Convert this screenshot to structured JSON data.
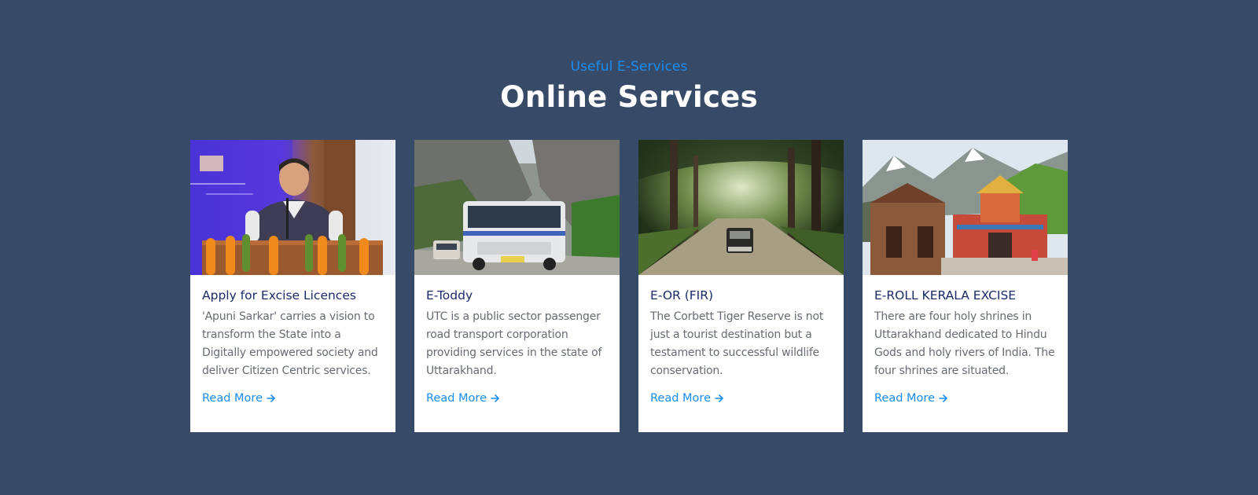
{
  "section": {
    "eyebrow": "Useful E-Services",
    "title": "Online Services"
  },
  "cards": [
    {
      "title": "Apply for Excise Licences",
      "text": "'Apuni Sarkar' carries a vision to transform the State into a Digitally empowered society and deliver Citizen Centric services.",
      "link": "Read More",
      "image": "speaker-at-podium-photo"
    },
    {
      "title": "E-Toddy",
      "text": "UTC is a public sector passenger road transport corporation providing services in the state of Uttarakhand.",
      "link": "Read More",
      "image": "bus-in-mountains-photo"
    },
    {
      "title": "E-OR (FIR)",
      "text": "The Corbett Tiger Reserve is not just a tourist destination but a testament to successful wildlife conservation.",
      "link": "Read More",
      "image": "jeep-in-forest-photo"
    },
    {
      "title": "E-ROLL KERALA EXCISE",
      "text": "There are four holy shrines in Uttarakhand dedicated to Hindu Gods and holy rivers of India. The four shrines are situated.",
      "link": "Read More",
      "image": "temples-collage-photo"
    }
  ],
  "colors": {
    "background": "#374b69",
    "accent": "#1a8cf0",
    "card_title": "#1c2a6a",
    "card_text": "#666b74"
  }
}
